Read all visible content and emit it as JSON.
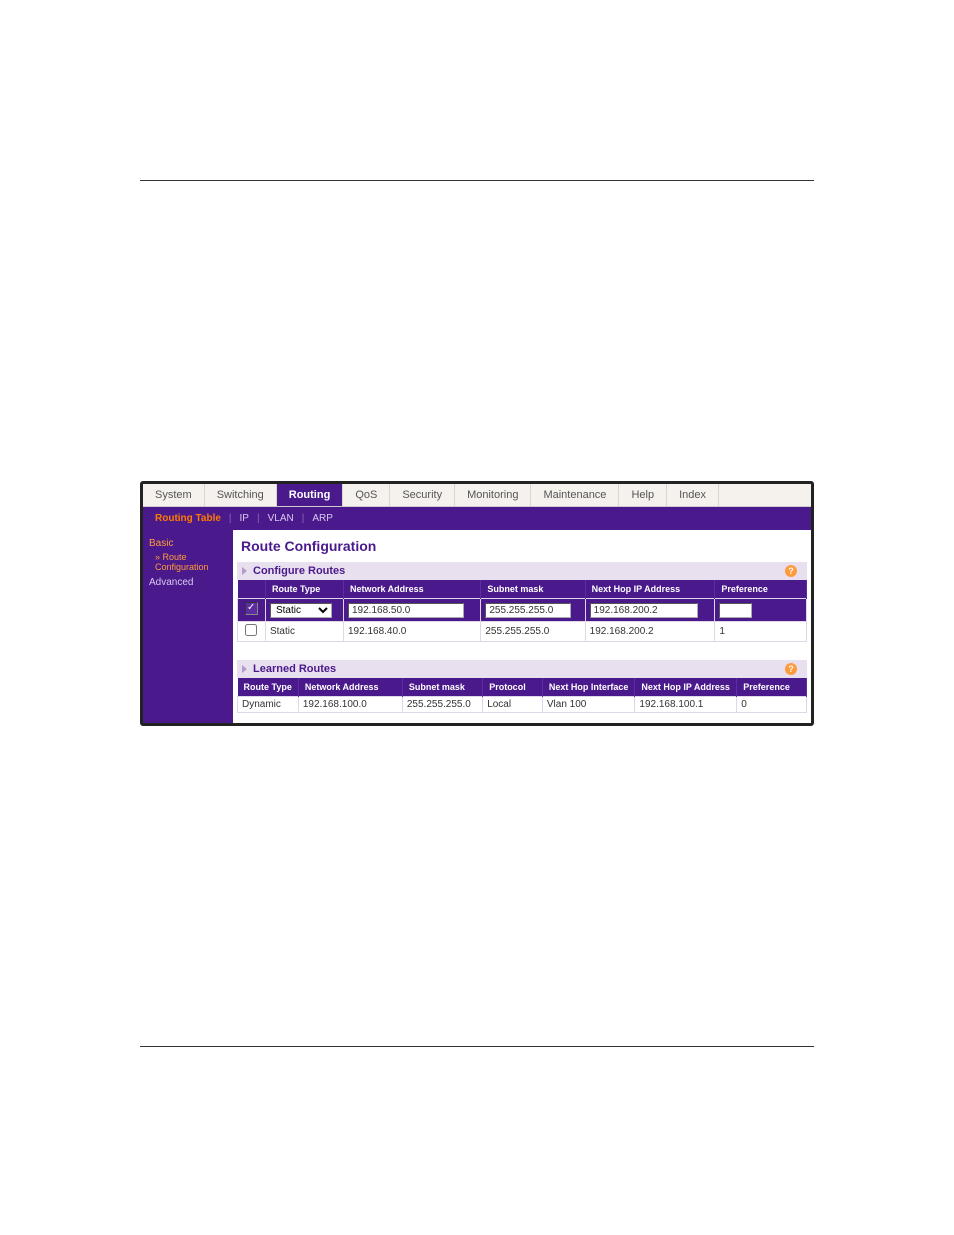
{
  "tabs": [
    "System",
    "Switching",
    "Routing",
    "QoS",
    "Security",
    "Monitoring",
    "Maintenance",
    "Help",
    "Index"
  ],
  "active_tab": 2,
  "subnav": [
    "Routing Table",
    "IP",
    "VLAN",
    "ARP"
  ],
  "subnav_active": 0,
  "sidebar": {
    "basic": "Basic",
    "route_cfg": "Route Configuration",
    "advanced": "Advanced"
  },
  "title": "Route Configuration",
  "sections": {
    "configure": "Configure Routes",
    "learned": "Learned Routes"
  },
  "headers": {
    "route_type": "Route Type",
    "network_address": "Network Address",
    "subnet_mask": "Subnet mask",
    "next_hop_ip": "Next Hop IP Address",
    "preference": "Preference",
    "network_address2": "Network Address",
    "protocol": "Protocol",
    "next_hop_iface": "Next Hop Interface"
  },
  "configure_edit": {
    "route_type": "Static",
    "network_address": "192.168.50.0",
    "subnet_mask": "255.255.255.0",
    "next_hop": "192.168.200.2",
    "preference": ""
  },
  "configure_rows": [
    {
      "route_type": "Static",
      "network_address": "192.168.40.0",
      "subnet_mask": "255.255.255.0",
      "next_hop": "192.168.200.2",
      "preference": "1"
    }
  ],
  "learned_rows": [
    {
      "route_type": "Dynamic",
      "network_address": "192.168.100.0",
      "subnet_mask": "255.255.255.0",
      "protocol": "Local",
      "next_hop_iface": "Vlan 100",
      "next_hop_ip": "192.168.100.1",
      "preference": "0"
    }
  ]
}
